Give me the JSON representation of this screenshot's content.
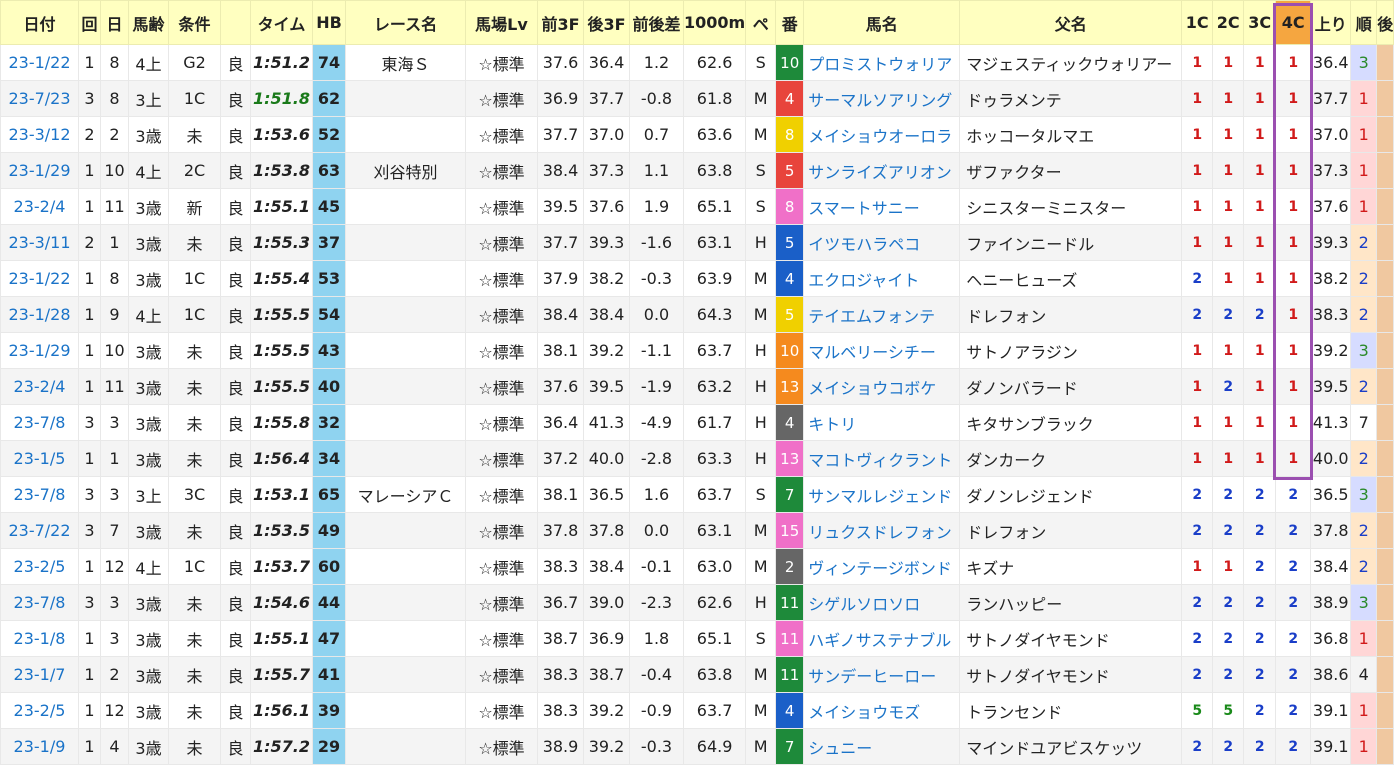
{
  "headers": [
    "日付",
    "回",
    "日",
    "馬齢",
    "条件",
    "",
    "タイム",
    "HB",
    "レース名",
    "馬場Lv",
    "前3F",
    "後3F",
    "前後差",
    "1000m",
    "ペ",
    "番",
    "馬名",
    "父名",
    "1C",
    "2C",
    "3C",
    "4C",
    "上り",
    "順",
    "後"
  ],
  "rows": [
    {
      "date": "23-1/22",
      "kai": "1",
      "day": "8",
      "age": "4上",
      "cond": "G2",
      "baba": "良",
      "time": "1:51.2",
      "time_green": false,
      "hb": "74",
      "race": "東海Ｓ",
      "lv": "☆標準",
      "f3": "37.6",
      "l3": "36.4",
      "diff": "1.2",
      "m1000": "62.6",
      "pace": "S",
      "num": "10",
      "numColor": "#1e8a3a",
      "horse": "プロミストウォリア",
      "sire": "マジェスティックウォリアー",
      "c1": "1",
      "c2": "1",
      "c3": "1",
      "c4": "1",
      "agari": "36.4",
      "rank": "3",
      "rankc": "3"
    },
    {
      "date": "23-7/23",
      "kai": "3",
      "day": "8",
      "age": "3上",
      "cond": "1C",
      "baba": "良",
      "time": "1:51.8",
      "time_green": true,
      "hb": "62",
      "race": "",
      "lv": "☆標準",
      "f3": "36.9",
      "l3": "37.7",
      "diff": "-0.8",
      "m1000": "61.8",
      "pace": "M",
      "num": "4",
      "numColor": "#e8443c",
      "horse": "サーマルソアリング",
      "sire": "ドゥラメンテ",
      "c1": "1",
      "c2": "1",
      "c3": "1",
      "c4": "1",
      "agari": "37.7",
      "rank": "1",
      "rankc": "1"
    },
    {
      "date": "23-3/12",
      "kai": "2",
      "day": "2",
      "age": "3歳",
      "cond": "未",
      "baba": "良",
      "time": "1:53.6",
      "time_green": false,
      "hb": "52",
      "race": "",
      "lv": "☆標準",
      "f3": "37.7",
      "l3": "37.0",
      "diff": "0.7",
      "m1000": "63.6",
      "pace": "M",
      "num": "8",
      "numColor": "#f0d000",
      "horse": "メイショウオーロラ",
      "sire": "ホッコータルマエ",
      "c1": "1",
      "c2": "1",
      "c3": "1",
      "c4": "1",
      "agari": "37.0",
      "rank": "1",
      "rankc": "1"
    },
    {
      "date": "23-1/29",
      "kai": "1",
      "day": "10",
      "age": "4上",
      "cond": "2C",
      "baba": "良",
      "time": "1:53.8",
      "time_green": false,
      "hb": "63",
      "race": "刈谷特別",
      "lv": "☆標準",
      "f3": "38.4",
      "l3": "37.3",
      "diff": "1.1",
      "m1000": "63.8",
      "pace": "S",
      "num": "5",
      "numColor": "#e8443c",
      "horse": "サンライズアリオン",
      "sire": "ザファクター",
      "c1": "1",
      "c2": "1",
      "c3": "1",
      "c4": "1",
      "agari": "37.3",
      "rank": "1",
      "rankc": "1"
    },
    {
      "date": "23-2/4",
      "kai": "1",
      "day": "11",
      "age": "3歳",
      "cond": "新",
      "baba": "良",
      "time": "1:55.1",
      "time_green": false,
      "hb": "45",
      "race": "",
      "lv": "☆標準",
      "f3": "39.5",
      "l3": "37.6",
      "diff": "1.9",
      "m1000": "65.1",
      "pace": "S",
      "num": "8",
      "numColor": "#f070c8",
      "horse": "スマートサニー",
      "sire": "シニスターミニスター",
      "c1": "1",
      "c2": "1",
      "c3": "1",
      "c4": "1",
      "agari": "37.6",
      "rank": "1",
      "rankc": "1"
    },
    {
      "date": "23-3/11",
      "kai": "2",
      "day": "1",
      "age": "3歳",
      "cond": "未",
      "baba": "良",
      "time": "1:55.3",
      "time_green": false,
      "hb": "37",
      "race": "",
      "lv": "☆標準",
      "f3": "37.7",
      "l3": "39.3",
      "diff": "-1.6",
      "m1000": "63.1",
      "pace": "H",
      "num": "5",
      "numColor": "#1a5fc8",
      "horse": "イツモハラペコ",
      "sire": "ファインニードル",
      "c1": "1",
      "c2": "1",
      "c3": "1",
      "c4": "1",
      "agari": "39.3",
      "rank": "2",
      "rankc": "2"
    },
    {
      "date": "23-1/22",
      "kai": "1",
      "day": "8",
      "age": "3歳",
      "cond": "1C",
      "baba": "良",
      "time": "1:55.4",
      "time_green": false,
      "hb": "53",
      "race": "",
      "lv": "☆標準",
      "f3": "37.9",
      "l3": "38.2",
      "diff": "-0.3",
      "m1000": "63.9",
      "pace": "M",
      "num": "4",
      "numColor": "#1a5fc8",
      "horse": "エクロジャイト",
      "sire": "ヘニーヒューズ",
      "c1": "2",
      "c2": "1",
      "c3": "1",
      "c4": "1",
      "agari": "38.2",
      "rank": "2",
      "rankc": "2"
    },
    {
      "date": "23-1/28",
      "kai": "1",
      "day": "9",
      "age": "4上",
      "cond": "1C",
      "baba": "良",
      "time": "1:55.5",
      "time_green": false,
      "hb": "54",
      "race": "",
      "lv": "☆標準",
      "f3": "38.4",
      "l3": "38.4",
      "diff": "0.0",
      "m1000": "64.3",
      "pace": "M",
      "num": "5",
      "numColor": "#f0d000",
      "horse": "テイエムフォンテ",
      "sire": "ドレフォン",
      "c1": "2",
      "c2": "2",
      "c3": "2",
      "c4": "1",
      "agari": "38.3",
      "rank": "2",
      "rankc": "2"
    },
    {
      "date": "23-1/29",
      "kai": "1",
      "day": "10",
      "age": "3歳",
      "cond": "未",
      "baba": "良",
      "time": "1:55.5",
      "time_green": false,
      "hb": "43",
      "race": "",
      "lv": "☆標準",
      "f3": "38.1",
      "l3": "39.2",
      "diff": "-1.1",
      "m1000": "63.7",
      "pace": "H",
      "num": "10",
      "numColor": "#f58a1e",
      "horse": "マルベリーシチー",
      "sire": "サトノアラジン",
      "c1": "1",
      "c2": "1",
      "c3": "1",
      "c4": "1",
      "agari": "39.2",
      "rank": "3",
      "rankc": "3"
    },
    {
      "date": "23-2/4",
      "kai": "1",
      "day": "11",
      "age": "3歳",
      "cond": "未",
      "baba": "良",
      "time": "1:55.5",
      "time_green": false,
      "hb": "40",
      "race": "",
      "lv": "☆標準",
      "f3": "37.6",
      "l3": "39.5",
      "diff": "-1.9",
      "m1000": "63.2",
      "pace": "H",
      "num": "13",
      "numColor": "#f58a1e",
      "horse": "メイショウコボケ",
      "sire": "ダノンバラード",
      "c1": "1",
      "c2": "2",
      "c3": "1",
      "c4": "1",
      "agari": "39.5",
      "rank": "2",
      "rankc": "2"
    },
    {
      "date": "23-7/8",
      "kai": "3",
      "day": "3",
      "age": "3歳",
      "cond": "未",
      "baba": "良",
      "time": "1:55.8",
      "time_green": false,
      "hb": "32",
      "race": "",
      "lv": "☆標準",
      "f3": "36.4",
      "l3": "41.3",
      "diff": "-4.9",
      "m1000": "61.7",
      "pace": "H",
      "num": "4",
      "numColor": "#666666",
      "horse": "キトリ",
      "sire": "キタサンブラック",
      "c1": "1",
      "c2": "1",
      "c3": "1",
      "c4": "1",
      "agari": "41.3",
      "rank": "7",
      "rankc": "0"
    },
    {
      "date": "23-1/5",
      "kai": "1",
      "day": "1",
      "age": "3歳",
      "cond": "未",
      "baba": "良",
      "time": "1:56.4",
      "time_green": false,
      "hb": "34",
      "race": "",
      "lv": "☆標準",
      "f3": "37.2",
      "l3": "40.0",
      "diff": "-2.8",
      "m1000": "63.3",
      "pace": "H",
      "num": "13",
      "numColor": "#f070c8",
      "horse": "マコトヴィクラント",
      "sire": "ダンカーク",
      "c1": "1",
      "c2": "1",
      "c3": "1",
      "c4": "1",
      "agari": "40.0",
      "rank": "2",
      "rankc": "2"
    },
    {
      "date": "23-7/8",
      "kai": "3",
      "day": "3",
      "age": "3上",
      "cond": "3C",
      "baba": "良",
      "time": "1:53.1",
      "time_green": false,
      "hb": "65",
      "race": "マレーシアＣ",
      "lv": "☆標準",
      "f3": "38.1",
      "l3": "36.5",
      "diff": "1.6",
      "m1000": "63.7",
      "pace": "S",
      "num": "7",
      "numColor": "#1e8a3a",
      "horse": "サンマルレジェンド",
      "sire": "ダノンレジェンド",
      "c1": "2",
      "c2": "2",
      "c3": "2",
      "c4": "2",
      "agari": "36.5",
      "rank": "3",
      "rankc": "3"
    },
    {
      "date": "23-7/22",
      "kai": "3",
      "day": "7",
      "age": "3歳",
      "cond": "未",
      "baba": "良",
      "time": "1:53.5",
      "time_green": false,
      "hb": "49",
      "race": "",
      "lv": "☆標準",
      "f3": "37.8",
      "l3": "37.8",
      "diff": "0.0",
      "m1000": "63.1",
      "pace": "M",
      "num": "15",
      "numColor": "#f070c8",
      "horse": "リュクスドレフォン",
      "sire": "ドレフォン",
      "c1": "2",
      "c2": "2",
      "c3": "2",
      "c4": "2",
      "agari": "37.8",
      "rank": "2",
      "rankc": "2"
    },
    {
      "date": "23-2/5",
      "kai": "1",
      "day": "12",
      "age": "4上",
      "cond": "1C",
      "baba": "良",
      "time": "1:53.7",
      "time_green": false,
      "hb": "60",
      "race": "",
      "lv": "☆標準",
      "f3": "38.3",
      "l3": "38.4",
      "diff": "-0.1",
      "m1000": "63.0",
      "pace": "M",
      "num": "2",
      "numColor": "#666666",
      "horse": "ヴィンテージボンド",
      "sire": "キズナ",
      "c1": "1",
      "c2": "1",
      "c3": "2",
      "c4": "2",
      "agari": "38.4",
      "rank": "2",
      "rankc": "2"
    },
    {
      "date": "23-7/8",
      "kai": "3",
      "day": "3",
      "age": "3歳",
      "cond": "未",
      "baba": "良",
      "time": "1:54.6",
      "time_green": false,
      "hb": "44",
      "race": "",
      "lv": "☆標準",
      "f3": "36.7",
      "l3": "39.0",
      "diff": "-2.3",
      "m1000": "62.6",
      "pace": "H",
      "num": "11",
      "numColor": "#1e8a3a",
      "horse": "シゲルソロソロ",
      "sire": "ランハッピー",
      "c1": "2",
      "c2": "2",
      "c3": "2",
      "c4": "2",
      "agari": "38.9",
      "rank": "3",
      "rankc": "3"
    },
    {
      "date": "23-1/8",
      "kai": "1",
      "day": "3",
      "age": "3歳",
      "cond": "未",
      "baba": "良",
      "time": "1:55.1",
      "time_green": false,
      "hb": "47",
      "race": "",
      "lv": "☆標準",
      "f3": "38.7",
      "l3": "36.9",
      "diff": "1.8",
      "m1000": "65.1",
      "pace": "S",
      "num": "11",
      "numColor": "#f070c8",
      "horse": "ハギノサステナブル",
      "sire": "サトノダイヤモンド",
      "c1": "2",
      "c2": "2",
      "c3": "2",
      "c4": "2",
      "agari": "36.8",
      "rank": "1",
      "rankc": "1"
    },
    {
      "date": "23-1/7",
      "kai": "1",
      "day": "2",
      "age": "3歳",
      "cond": "未",
      "baba": "良",
      "time": "1:55.7",
      "time_green": false,
      "hb": "41",
      "race": "",
      "lv": "☆標準",
      "f3": "38.3",
      "l3": "38.7",
      "diff": "-0.4",
      "m1000": "63.8",
      "pace": "M",
      "num": "11",
      "numColor": "#1e8a3a",
      "horse": "サンデーヒーロー",
      "sire": "サトノダイヤモンド",
      "c1": "2",
      "c2": "2",
      "c3": "2",
      "c4": "2",
      "agari": "38.6",
      "rank": "4",
      "rankc": "0"
    },
    {
      "date": "23-2/5",
      "kai": "1",
      "day": "12",
      "age": "3歳",
      "cond": "未",
      "baba": "良",
      "time": "1:56.1",
      "time_green": false,
      "hb": "39",
      "race": "",
      "lv": "☆標準",
      "f3": "38.3",
      "l3": "39.2",
      "diff": "-0.9",
      "m1000": "63.7",
      "pace": "M",
      "num": "4",
      "numColor": "#1a5fc8",
      "horse": "メイショウモズ",
      "sire": "トランセンド",
      "c1": "5",
      "c2": "5",
      "c3": "2",
      "c4": "2",
      "agari": "39.1",
      "rank": "1",
      "rankc": "1"
    },
    {
      "date": "23-1/9",
      "kai": "1",
      "day": "4",
      "age": "3歳",
      "cond": "未",
      "baba": "良",
      "time": "1:57.2",
      "time_green": false,
      "hb": "29",
      "race": "",
      "lv": "☆標準",
      "f3": "38.9",
      "l3": "39.2",
      "diff": "-0.3",
      "m1000": "64.9",
      "pace": "M",
      "num": "7",
      "numColor": "#1e8a3a",
      "horse": "シュニー",
      "sire": "マインドユアビスケッツ",
      "c1": "2",
      "c2": "2",
      "c3": "2",
      "c4": "2",
      "agari": "39.1",
      "rank": "1",
      "rankc": "1"
    }
  ]
}
